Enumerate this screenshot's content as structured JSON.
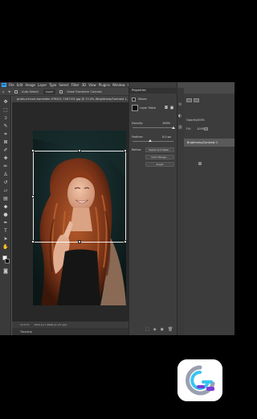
{
  "menu": {
    "items": [
      "File",
      "Edit",
      "Image",
      "Layer",
      "Type",
      "Select",
      "Filter",
      "3D",
      "View",
      "Plugins",
      "Window",
      "Help"
    ]
  },
  "options_bar": {
    "auto_select": "Auto-Select:",
    "layer": "Layer",
    "show_transform": "Show Transform Controls"
  },
  "document": {
    "tab_title": "gratis-inmunt-karvolten-976421-7467191.jpg @ 13.4% (Brightness/Contrast 1, Layer Mask/8) *",
    "zoom": "13.17%",
    "dimensions": "3024 px x 4608 px (72 ppi)",
    "timeline_label": "Timeline"
  },
  "properties": {
    "panel_title": "Properties",
    "section": "Masks",
    "layer_mask": "Layer Mask",
    "density_label": "Density:",
    "density_value": "100%",
    "feather_label": "Feather:",
    "feather_value": "0.0 px",
    "refine_label": "Refine:",
    "select_mask": "Select and Mask...",
    "color_range": "Color Range...",
    "invert": "Invert"
  },
  "layers": {
    "opacity_label": "Opacity:",
    "opacity_value": "100%",
    "fill_label": "Fill:",
    "fill_value": "100%",
    "selected_layer": "Brightness/Contrast 1"
  }
}
